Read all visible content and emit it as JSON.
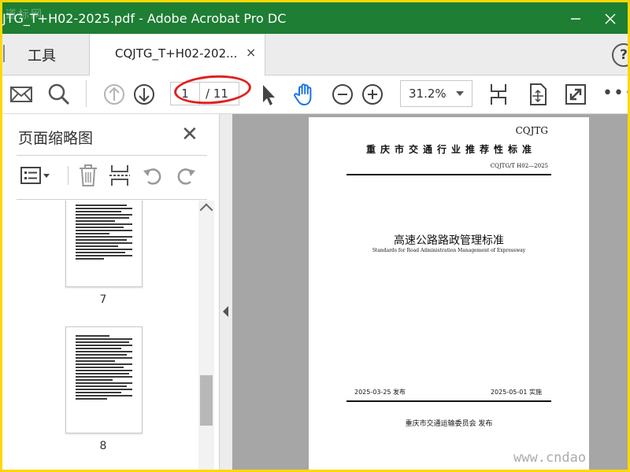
{
  "window": {
    "title": "JTG_T+H02-2025.pdf - Adobe Acrobat Pro DC",
    "watermark_top_left": "道标网",
    "watermark_bottom_right": "www.cndao"
  },
  "tabs": {
    "tools_label": "工具",
    "doc_label": "CQJTG_T+H02-202...",
    "close_glyph": "×",
    "help_glyph": "?"
  },
  "toolbar": {
    "page_current": "1",
    "page_total": "/ 11",
    "zoom": "31.2%",
    "more": "•••"
  },
  "sidebar": {
    "title": "页面缩略图",
    "close_glyph": "✕",
    "thumbnails": [
      {
        "page": "7"
      },
      {
        "page": "8"
      }
    ]
  },
  "document": {
    "abbr": "CQJTG",
    "category": "重庆市交通行业推荐性标准",
    "code": "CQJTG/T H02—2025",
    "title_cn": "高速公路路政管理标准",
    "title_en": "Standards for Road Administration Management of Expressway",
    "issue_date": "2025-03-25 发布",
    "implement_date": "2025-05-01 实施",
    "publisher": "重庆市交通运输委员会    发布"
  },
  "colors": {
    "titlebar": "#1e7e34",
    "frame_border": "#ffd700",
    "annotation_ellipse": "#e02020",
    "hand_tool": "#1a73e8"
  }
}
